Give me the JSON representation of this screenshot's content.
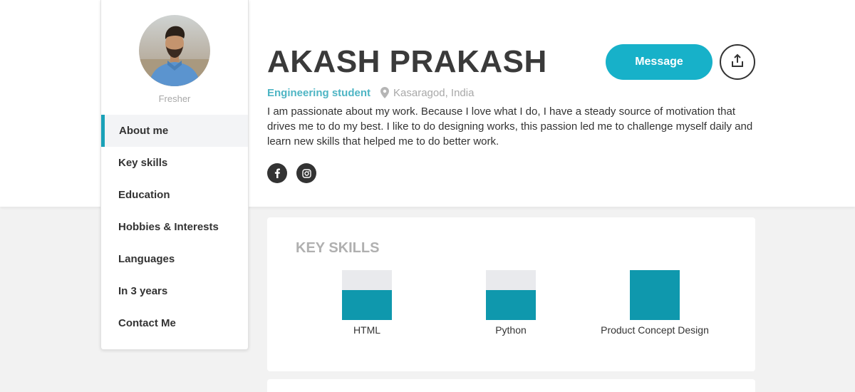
{
  "profile": {
    "name": "AKASH PRAKASH",
    "role_label": "Fresher",
    "occupation": "Engineering student",
    "location": "Kasaragod, India",
    "bio": "I am passionate about my work. Because I love what I do, I have a steady source of motivation that drives me to do my best. I like to do designing works, this passion led me to challenge myself daily and learn new skills that helped me to do better work."
  },
  "actions": {
    "message_label": "Message",
    "share_icon": "share-icon"
  },
  "socials": [
    {
      "name": "facebook-icon",
      "glyph": "f"
    },
    {
      "name": "instagram-icon",
      "glyph": ""
    }
  ],
  "sidebar": {
    "items": [
      {
        "label": "About me",
        "active": true
      },
      {
        "label": "Key skills",
        "active": false
      },
      {
        "label": "Education",
        "active": false
      },
      {
        "label": "Hobbies & Interests",
        "active": false
      },
      {
        "label": "Languages",
        "active": false
      },
      {
        "label": "In 3 years",
        "active": false
      },
      {
        "label": "Contact Me",
        "active": false
      }
    ]
  },
  "key_skills": {
    "heading": "KEY SKILLS",
    "skills": [
      {
        "label": "HTML",
        "level": 0.6
      },
      {
        "label": "Python",
        "level": 0.6
      },
      {
        "label": "Product Concept Design",
        "level": 1.0
      }
    ]
  },
  "colors": {
    "accent": "#17b1c9",
    "skill_fill": "#0f98ad",
    "skill_track": "#e9eaed",
    "occupation": "#4eb5c4"
  }
}
